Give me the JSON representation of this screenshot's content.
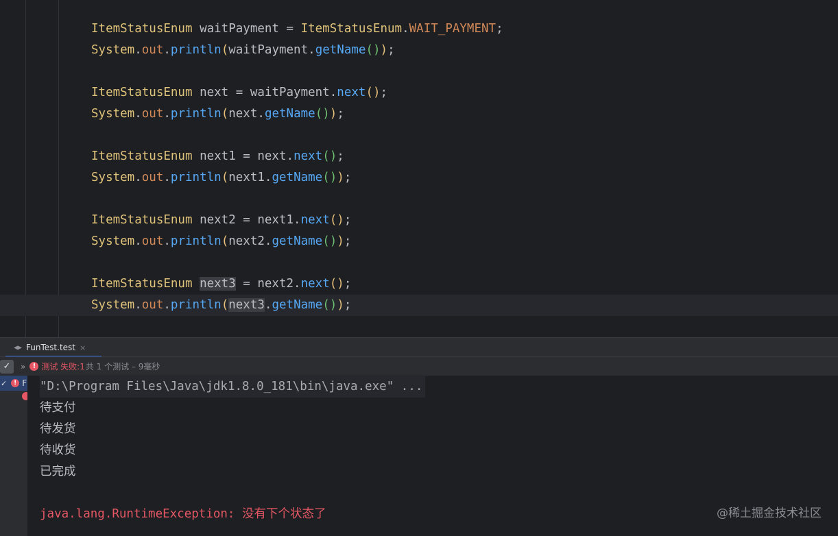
{
  "editor": {
    "lines": [
      {
        "type": "ItemStatusEnum",
        "var": "waitPayment",
        "eq": " = ",
        "rhs_obj": "ItemStatusEnum",
        "rhs_member": "WAIT_PAYMENT",
        "end": ";"
      },
      {
        "sys": "System",
        "out": "out",
        "method": "println",
        "arg": "waitPayment",
        "call": "getName"
      },
      {
        "type": "ItemStatusEnum",
        "var": "next",
        "eq": " = ",
        "rhs_obj": "waitPayment",
        "rhs_member": "next"
      },
      {
        "sys": "System",
        "out": "out",
        "method": "println",
        "arg": "next",
        "call": "getName"
      },
      {
        "type": "ItemStatusEnum",
        "var": "next1",
        "eq": " = ",
        "rhs_obj": "next",
        "rhs_member": "next"
      },
      {
        "sys": "System",
        "out": "out",
        "method": "println",
        "arg": "next1",
        "call": "getName"
      },
      {
        "type": "ItemStatusEnum",
        "var": "next2",
        "eq": " = ",
        "rhs_obj": "next1",
        "rhs_member": "next"
      },
      {
        "sys": "System",
        "out": "out",
        "method": "println",
        "arg": "next2",
        "call": "getName"
      },
      {
        "type": "ItemStatusEnum",
        "var": "next3",
        "eq": " = ",
        "rhs_obj": "next2",
        "rhs_member": "next"
      },
      {
        "sys": "System",
        "out": "out",
        "method": "println",
        "arg": "next3",
        "call": "getName"
      }
    ]
  },
  "run_panel": {
    "tab_label": "FunTest.test",
    "tab_close": "×",
    "status": {
      "fail_text": "测试 失败:",
      "fail_count": "1",
      "summary": "共 1 个测试 – 9毫秒"
    },
    "tree": {
      "label": "F"
    },
    "console": {
      "command": "\"D:\\Program Files\\Java\\jdk1.8.0_181\\bin\\java.exe\" ...",
      "outputs": [
        "待支付",
        "待发货",
        "待收货",
        "已完成"
      ],
      "exception_class": "java.lang.RuntimeException:",
      "exception_message": "没有下个状态了"
    }
  },
  "watermark": "@稀土掘金技术社区",
  "colors": {
    "background": "#1e1f22",
    "keyword_type": "#e0c37a",
    "static_field": "#d38a58",
    "method": "#56a8f5",
    "field_out": "#c77dbb",
    "error": "#e55765",
    "tab_accent": "#3574f0"
  }
}
